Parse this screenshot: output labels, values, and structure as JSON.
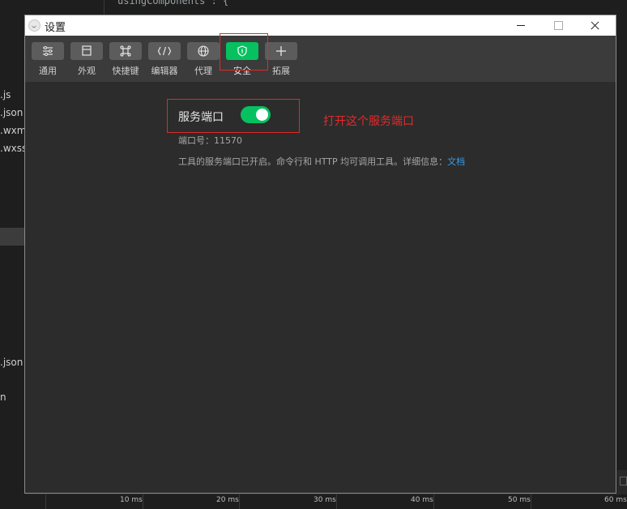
{
  "ide": {
    "code_top": "usingComponents\": {",
    "files": [
      ".js",
      ".json",
      ".wxml",
      ".wxss",
      ".json",
      "n"
    ],
    "timeline": [
      "10 ms",
      "20 ms",
      "30 ms",
      "40 ms",
      "50 ms",
      "60 ms"
    ]
  },
  "window": {
    "title": "设置",
    "toolbar": [
      {
        "label": "通用",
        "icon": "general-settings-icon",
        "active": false
      },
      {
        "label": "外观",
        "icon": "appearance-icon",
        "active": false
      },
      {
        "label": "快捷键",
        "icon": "shortcut-icon",
        "active": false
      },
      {
        "label": "编辑器",
        "icon": "editor-code-icon",
        "active": false
      },
      {
        "label": "代理",
        "icon": "globe-icon",
        "active": false
      },
      {
        "label": "安全",
        "icon": "shield-icon",
        "active": true
      },
      {
        "label": "拓展",
        "icon": "plus-icon",
        "active": false
      }
    ],
    "security": {
      "service_port_label": "服务端口",
      "service_port_enabled": true,
      "port_text": "端口号：11570",
      "description": "工具的服务端口已开启。命令行和 HTTP 均可调用工具。详细信息：",
      "doc_link": "文档"
    }
  },
  "annotation": {
    "text": "打开这个服务端口",
    "color": "#e02b2b"
  },
  "colors": {
    "accent": "#07c160",
    "link": "#3a9be6"
  }
}
